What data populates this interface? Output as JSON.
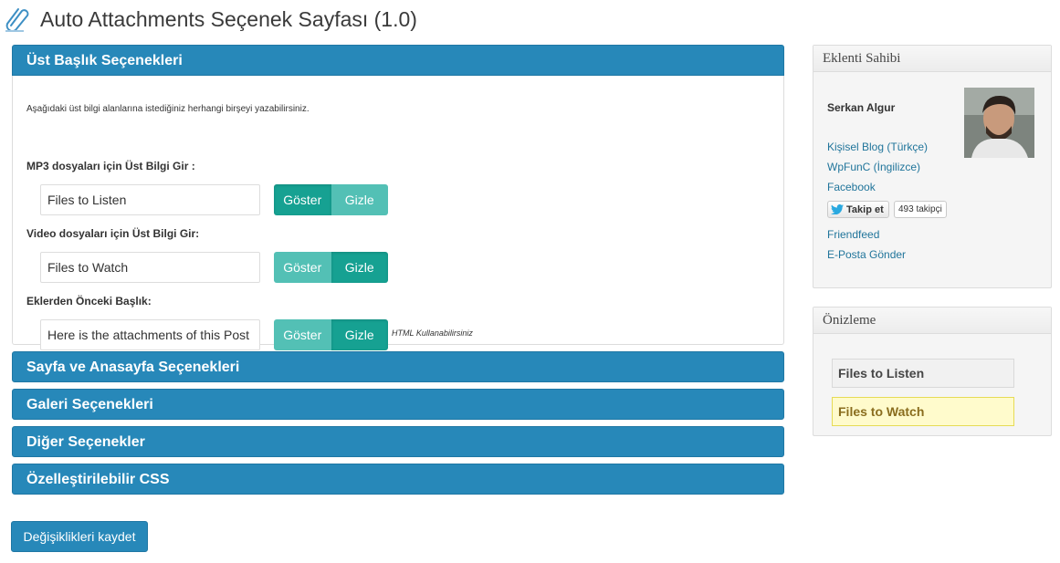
{
  "page": {
    "title": "Auto Attachments Seçenek Sayfası (1.0)"
  },
  "sections": {
    "header_options": {
      "title": "Üst Başlık Seçenekleri",
      "description": "Aşağıdaki üst bilgi alanlarına istediğiniz herhangi birşeyi yazabilirsiniz.",
      "fields": [
        {
          "label": "MP3 dosyaları için Üst Bilgi Gir :",
          "value": "Files to Listen",
          "show": "Göster",
          "hide": "Gizle",
          "active": "show"
        },
        {
          "label": "Video dosyaları için Üst Bilgi Gir:",
          "value": "Files to Watch",
          "show": "Göster",
          "hide": "Gizle",
          "active": "hide"
        },
        {
          "label": "Eklerden Önceki Başlık:",
          "value": "Here is the attachments of this Post",
          "show": "Göster",
          "hide": "Gizle",
          "active": "hide",
          "hint": "HTML Kullanabilirsiniz"
        }
      ]
    },
    "collapsed": [
      "Sayfa ve Anasayfa Seçenekleri",
      "Galeri Seçenekleri",
      "Diğer Seçenekler",
      "Özelleştirilebilir CSS"
    ]
  },
  "save_button": "Değişiklikleri kaydet",
  "sidebar": {
    "author_box": {
      "title": "Eklenti Sahibi",
      "name": "Serkan Algur",
      "links": [
        "Kişisel Blog (Türkçe)",
        "WpFunC (İngilizce)",
        "Facebook",
        "Friendfeed",
        "E-Posta Gönder"
      ],
      "follow_label": "Takip et",
      "follow_count": "493 takipçi"
    },
    "preview_box": {
      "title": "Önizleme",
      "items": [
        "Files to Listen",
        "Files to Watch"
      ]
    }
  },
  "colors": {
    "accent": "#2788b9",
    "toggle_active": "#16a192",
    "toggle_inactive": "#53c0b5",
    "link": "#21759b"
  }
}
